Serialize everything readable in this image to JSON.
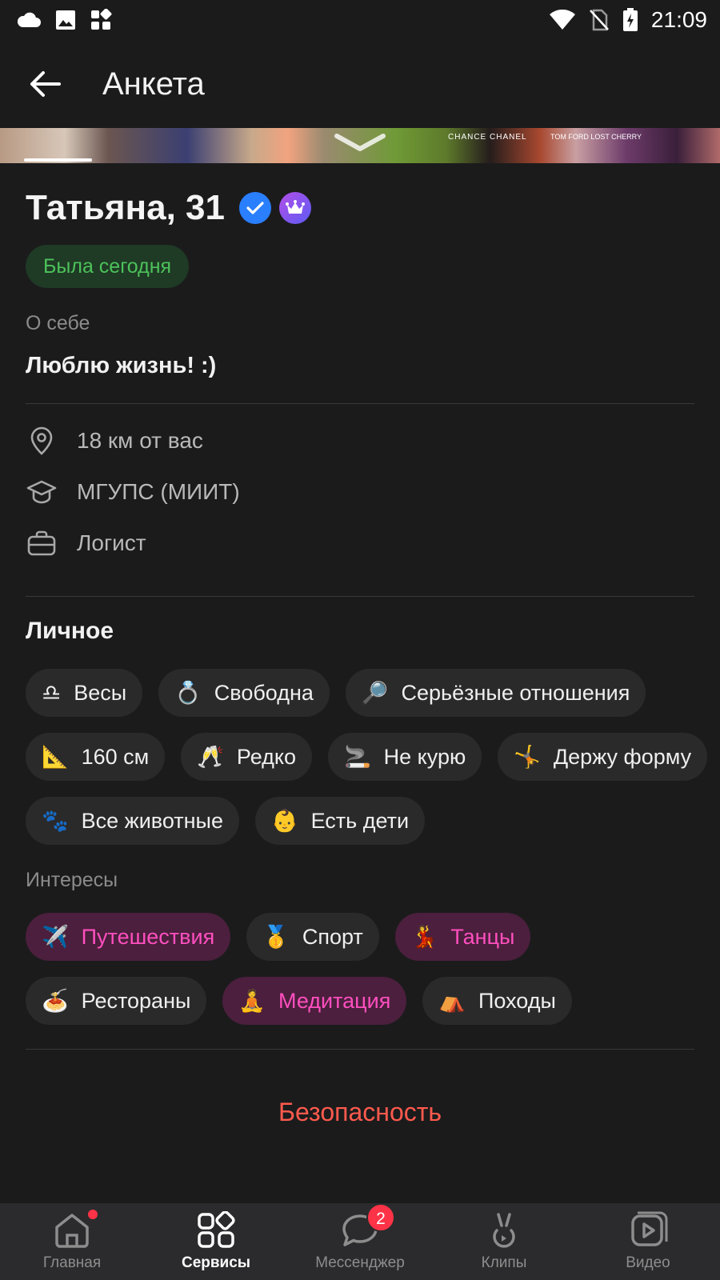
{
  "status": {
    "time": "21:09",
    "icons": [
      "cloud-icon",
      "image-icon",
      "apps-icon",
      "wifi-icon",
      "no-sim-icon",
      "battery-charging-icon"
    ]
  },
  "header": {
    "title": "Анкета",
    "back_icon": "arrow-left-icon"
  },
  "profile": {
    "name": "Татьяна, 31",
    "online": "Была сегодня",
    "about_label": "О себе",
    "about_text": "Люблю жизнь! :)"
  },
  "info": [
    {
      "icon": "location-pin-icon",
      "text": "18 км от вас"
    },
    {
      "icon": "graduation-cap-icon",
      "text": "МГУПС (МИИТ)"
    },
    {
      "icon": "briefcase-icon",
      "text": "Логист"
    }
  ],
  "personal": {
    "title": "Личное",
    "chips": [
      {
        "emoji": "♎",
        "label": "Весы"
      },
      {
        "emoji": "💍",
        "label": "Свободна"
      },
      {
        "emoji": "🔎",
        "label": "Серьёзные отношения"
      },
      {
        "emoji": "📐",
        "label": "160 см"
      },
      {
        "emoji": "🥂",
        "label": "Редко"
      },
      {
        "emoji": "🚬",
        "label": "Не курю"
      },
      {
        "emoji": "🤸",
        "label": "Держу форму"
      },
      {
        "emoji": "🐾",
        "label": "Все животные"
      },
      {
        "emoji": "👶",
        "label": "Есть дети"
      }
    ]
  },
  "interests": {
    "label": "Интересы",
    "chips": [
      {
        "emoji": "✈️",
        "label": "Путешествия",
        "active": true
      },
      {
        "emoji": "🥇",
        "label": "Спорт",
        "active": false
      },
      {
        "emoji": "💃",
        "label": "Танцы",
        "active": true
      },
      {
        "emoji": "🍝",
        "label": "Рестораны",
        "active": false
      },
      {
        "emoji": "🧘",
        "label": "Медитация",
        "active": true
      },
      {
        "emoji": "⛺",
        "label": "Походы",
        "active": false
      }
    ]
  },
  "safety_label": "Безопасность",
  "photo": {
    "brand_1": "CHANCE CHANEL",
    "brand_2": "TOM FORD LOST CHERRY"
  },
  "tabs": [
    {
      "label": "Главная",
      "icon": "home-icon",
      "dot": true
    },
    {
      "label": "Сервисы",
      "icon": "services-grid-icon",
      "active": true
    },
    {
      "label": "Мессенджер",
      "icon": "chat-bubble-icon",
      "badge": "2"
    },
    {
      "label": "Клипы",
      "icon": "clips-icon"
    },
    {
      "label": "Видео",
      "icon": "video-icon"
    }
  ],
  "colors": {
    "background": "#1b1b1c",
    "online_green": "#4cc25a",
    "accent_pink": "#ff4fbf",
    "danger_red": "#ff5a4d",
    "verified_blue": "#2a7fff"
  }
}
